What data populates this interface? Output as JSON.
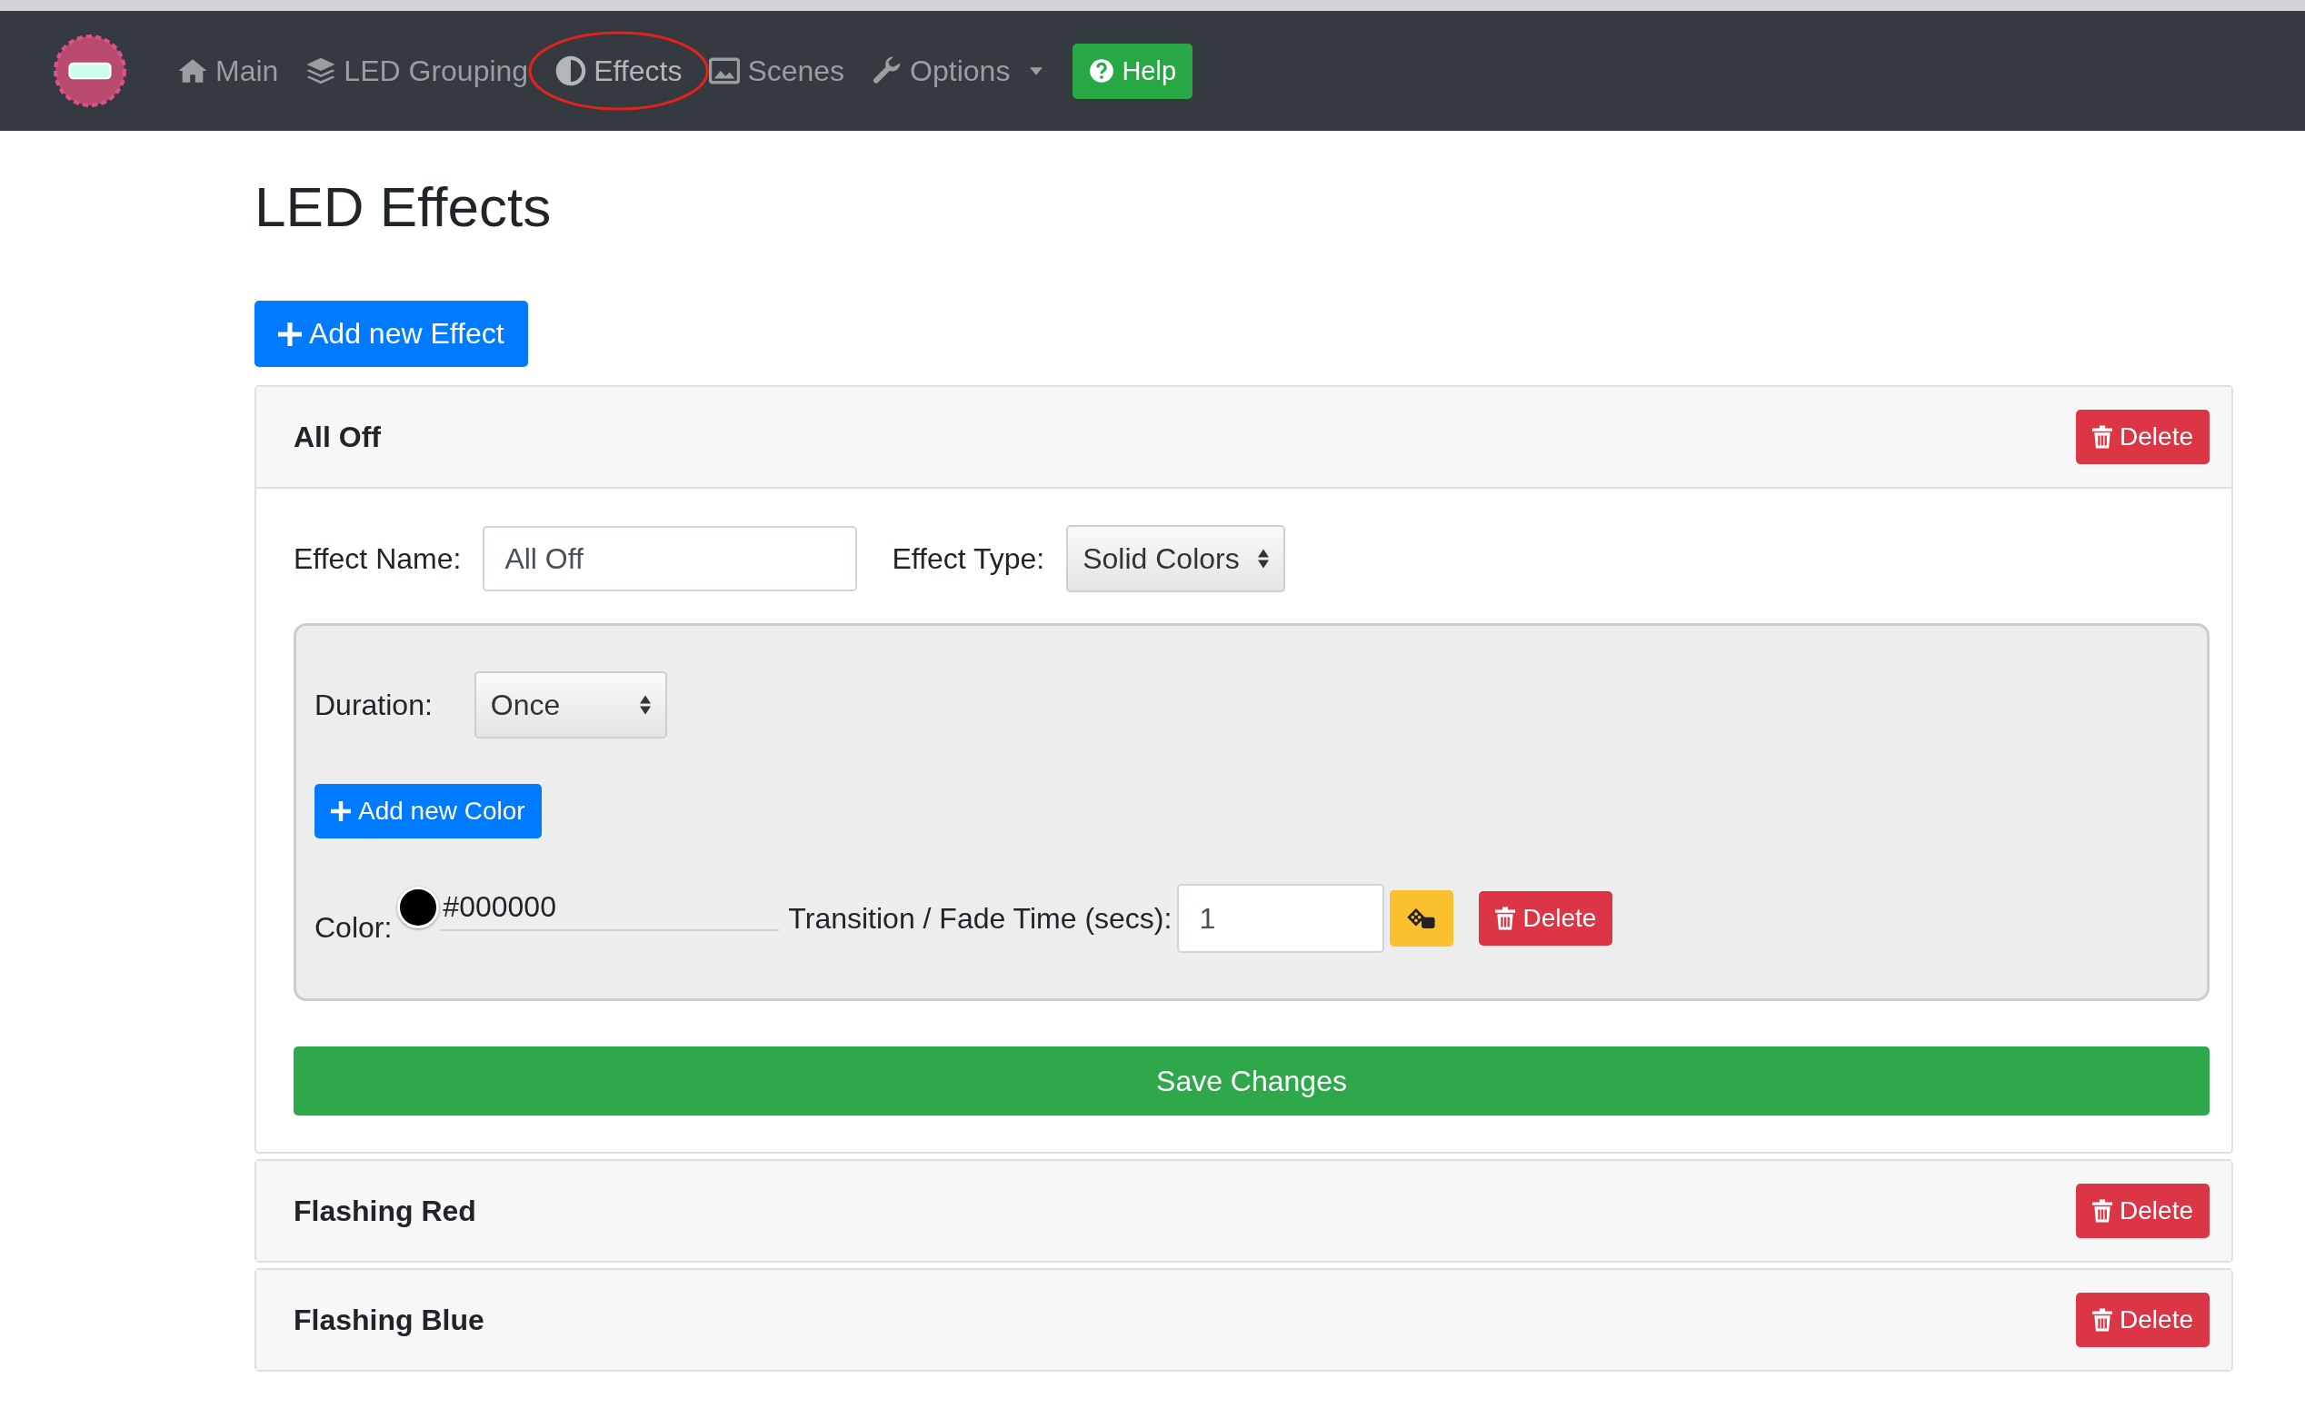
{
  "navbar": {
    "items": [
      {
        "kind": "link",
        "label": "Main",
        "selected": false,
        "dropdown": false
      },
      {
        "kind": "link",
        "label": "LED Grouping",
        "selected": false,
        "dropdown": false
      },
      {
        "kind": "link",
        "label": "Effects",
        "selected": true,
        "dropdown": false
      },
      {
        "kind": "link",
        "label": "Scenes",
        "selected": false,
        "dropdown": false
      },
      {
        "kind": "link",
        "label": "Options",
        "selected": false,
        "dropdown": true
      }
    ],
    "help_button": "Help"
  },
  "page_title": "LED Effects",
  "add_effect_button": "Add new Effect",
  "effects": [
    {
      "title": "All Off",
      "expanded": true,
      "delete_button": "Delete",
      "form": {
        "name_label": "Effect Name:",
        "name_value": "All Off",
        "type_label": "Effect Type:",
        "type_value": "Solid Colors",
        "duration_label": "Duration:",
        "duration_value": "Once",
        "add_color_button": "Add new Color",
        "colors": [
          {
            "label": "Color:",
            "color": "#000000",
            "hex": "#000000",
            "transition_label": "Transition / Fade Time (secs):",
            "transition_value": "1",
            "delete_button": "Delete"
          }
        ],
        "save_button": "Save Changes"
      }
    },
    {
      "title": "Flashing Red",
      "expanded": false,
      "delete_button": "Delete"
    },
    {
      "title": "Flashing Blue",
      "expanded": false,
      "delete_button": "Delete"
    }
  ]
}
